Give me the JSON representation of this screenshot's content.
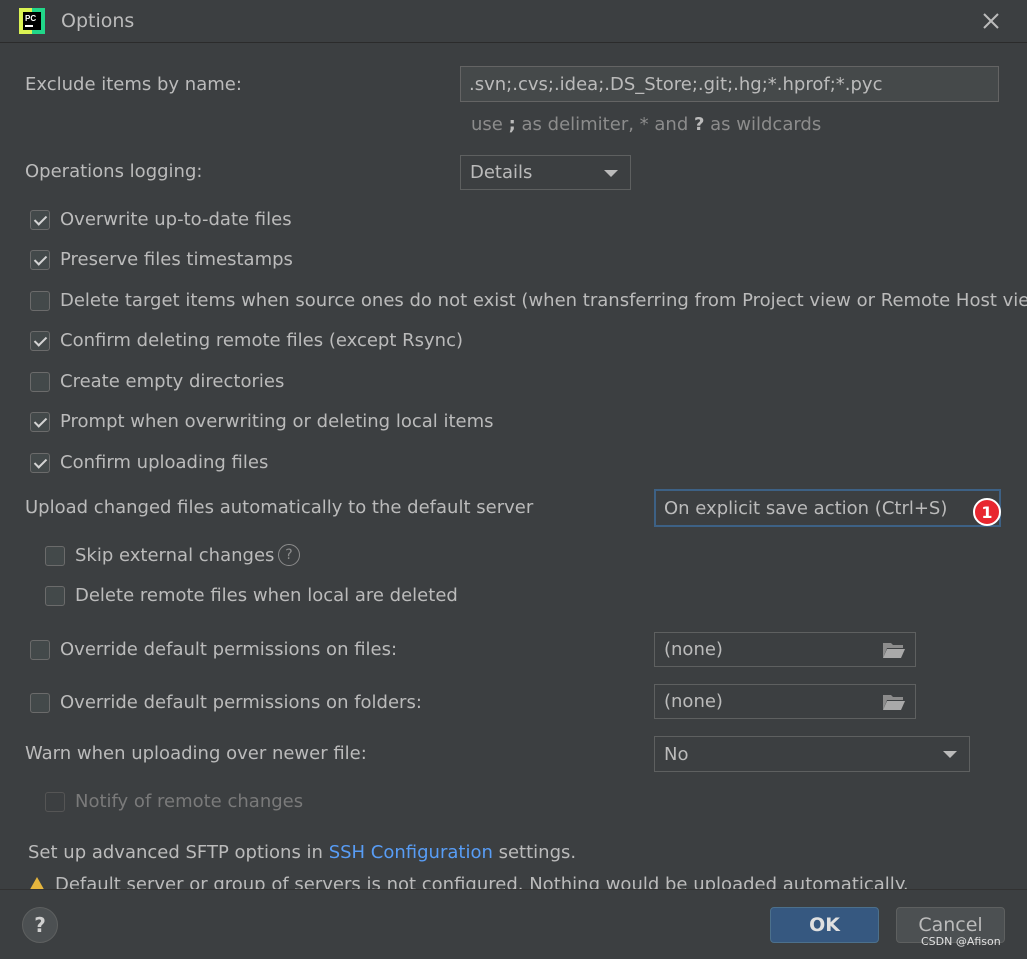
{
  "window": {
    "title": "Options",
    "app_icon": "pycharm-icon",
    "app_icon_text": "PC"
  },
  "exclude": {
    "label": "Exclude items by name:",
    "value": ".svn;.cvs;.idea;.DS_Store;.git;.hg;*.hprof;*.pyc",
    "hint_prefix": "use ",
    "hint_semicolon": ";",
    "hint_middle": " as delimiter, * and ",
    "hint_question": "?",
    "hint_suffix": " as wildcards"
  },
  "logging": {
    "label": "Operations logging:",
    "value": "Details"
  },
  "checkboxes": [
    {
      "label": "Overwrite up-to-date files",
      "checked": true
    },
    {
      "label": "Preserve files timestamps",
      "checked": true
    },
    {
      "label": "Delete target items when source ones do not exist (when transferring from Project view or Remote Host view)",
      "checked": false
    },
    {
      "label": "Confirm deleting remote files (except Rsync)",
      "checked": true
    },
    {
      "label": "Create empty directories",
      "checked": false
    },
    {
      "label": "Prompt when overwriting or deleting local items",
      "checked": true
    },
    {
      "label": "Confirm uploading files",
      "checked": true
    }
  ],
  "upload": {
    "label": "Upload changed files automatically to the default server",
    "value": "On explicit save action (Ctrl+S)",
    "badge": "1",
    "skip_external_label": "Skip external changes",
    "skip_external_help": "?",
    "delete_remote_label": "Delete remote files when local are deleted"
  },
  "permissions": {
    "files_label": "Override default permissions on files:",
    "files_value": "(none)",
    "folders_label": "Override default permissions on folders:",
    "folders_value": "(none)"
  },
  "warn": {
    "label": "Warn when uploading over newer file:",
    "value": "No",
    "notify_label": "Notify of remote changes"
  },
  "sftp": {
    "prefix": "Set up advanced SFTP options in ",
    "link": "SSH Configuration",
    "suffix": " settings."
  },
  "warning_message": "Default server or group of servers is not configured. Nothing would be uploaded automatically.",
  "footer": {
    "help": "?",
    "ok": "OK",
    "cancel": "Cancel"
  },
  "watermark": "CSDN @Afison",
  "colors": {
    "background": "#3c3f41",
    "accent": "#365880",
    "link": "#589df6",
    "badge": "#e8262f",
    "warning": "#e5b53d"
  }
}
